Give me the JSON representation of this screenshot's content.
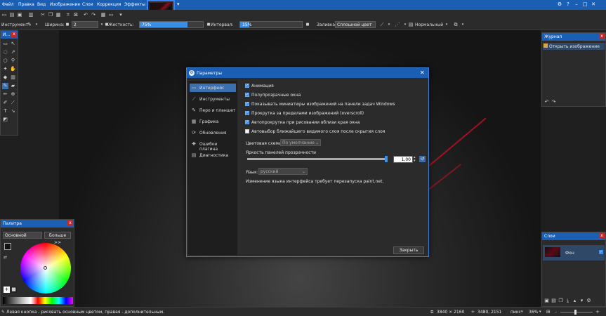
{
  "menubar": {
    "items": [
      "Файл",
      "Правка",
      "Вид",
      "Изображение",
      "Слои",
      "Коррекция",
      "Эффекты"
    ]
  },
  "toolbar": {
    "tool_label": "Инструмент:",
    "width_label": "Ширина:",
    "width_value": "2",
    "hardness_label": "Жесткость:",
    "hardness_value": "75%",
    "hardness_level": 0.75,
    "interval_label": "Интервал:",
    "interval_value": "15%",
    "interval_level": 0.15,
    "fill_label": "Заливка:",
    "fill_value": "Сплошной цвет",
    "blend_value": "Нормальный"
  },
  "tools_panel": {
    "title": "И..."
  },
  "history_panel": {
    "title": "Журнал",
    "items": [
      "Открыть изображение"
    ]
  },
  "layers_panel": {
    "title": "Слои",
    "layers": [
      "Фон"
    ]
  },
  "palette_panel": {
    "title": "Палитра",
    "mode_value": "Основной",
    "more_button": "Больше >>"
  },
  "dialog": {
    "title": "Параметры",
    "nav": [
      "Интерфейс",
      "Инструменты",
      "Перо и планшет",
      "Графика",
      "Обновления",
      "Ошибки плагина",
      "Диагностика"
    ],
    "options": [
      {
        "label": "Анимация",
        "checked": true
      },
      {
        "label": "Полупрозрачные окна",
        "checked": true
      },
      {
        "label": "Показывать миниатюры изображений на панели задач Windows",
        "checked": true
      },
      {
        "label": "Прокрутка за пределами изображений (overscroll)",
        "checked": true
      },
      {
        "label": "Автопрокрутка при рисовании вблизи края окна",
        "checked": true
      },
      {
        "label": "Автовыбор ближайшего видимого слоя после скрытия слоя",
        "checked": false
      }
    ],
    "color_scheme_label": "Цветовая схема:",
    "color_scheme_value": "По умолчанию",
    "transparency_label": "Яркость панелей прозрачности",
    "transparency_value": "1,00",
    "transparency_level": 1.0,
    "language_label": "Язык:",
    "language_value": "русский",
    "restart_note": "Изменение языка интерфейса требует перезапуска paint.net.",
    "close_button": "Закрыть"
  },
  "statusbar": {
    "hint": "Левая кнопка - рисовать основным цветом, правая - дополнительным.",
    "image_size": "3840 × 2160",
    "cursor_pos": "3480, 2151",
    "units": "пикс",
    "zoom": "36%"
  },
  "colors": {
    "accent": "#1a5fb4",
    "panel_bg": "#2b2b2b",
    "active_nav": "#3a6fb0",
    "close_red": "#c62828"
  }
}
